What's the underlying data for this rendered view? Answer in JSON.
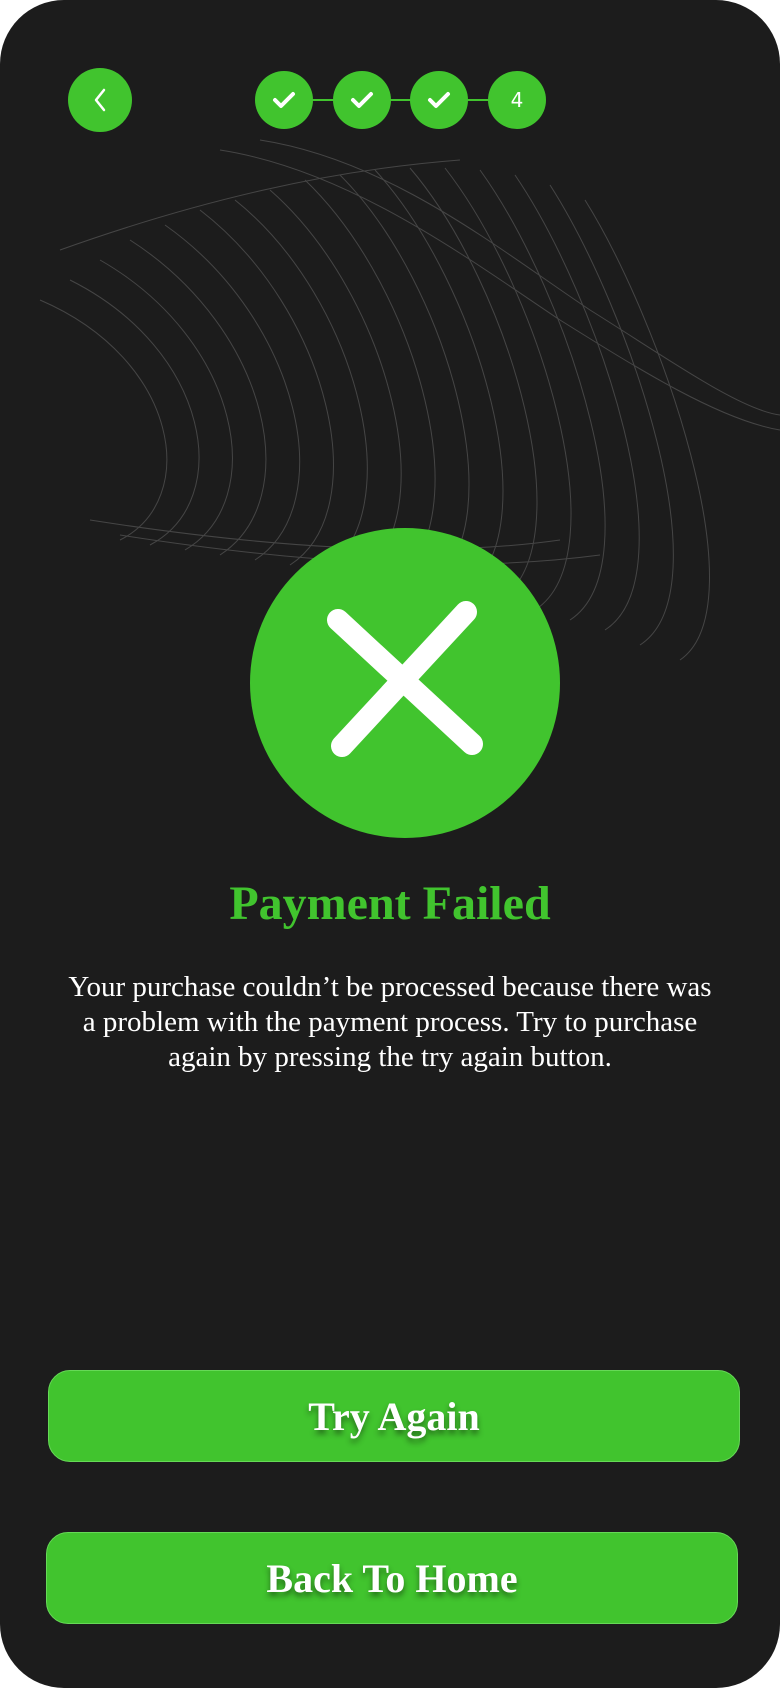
{
  "header": {
    "back_icon": "chevron-left-icon",
    "steps": [
      {
        "state": "completed",
        "icon": "checkmark-icon"
      },
      {
        "state": "completed",
        "icon": "checkmark-icon"
      },
      {
        "state": "completed",
        "icon": "checkmark-icon"
      },
      {
        "state": "current",
        "label": "4"
      }
    ]
  },
  "status": {
    "icon": "close-x-icon",
    "title": "Payment Failed",
    "message": "Your purchase couldn’t be processed because there was a problem with the payment process. Try to purchase again by pressing the try again button."
  },
  "actions": {
    "try_again_label": "Try Again",
    "back_home_label": "Back To Home"
  },
  "colors": {
    "background": "#1c1c1c",
    "accent": "#41c42e",
    "text": "#ffffff"
  }
}
